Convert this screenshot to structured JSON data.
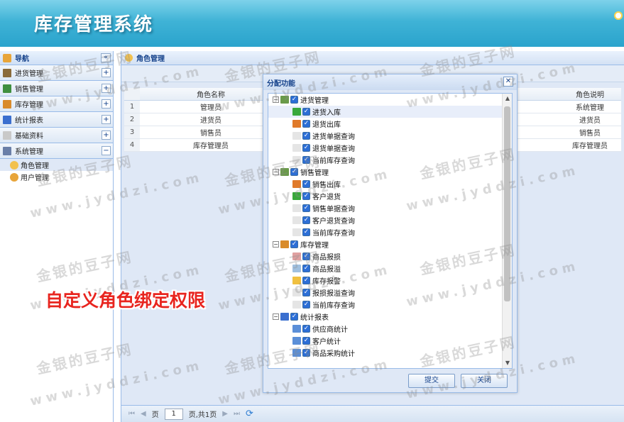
{
  "app": {
    "title": "库存管理系统"
  },
  "nav": {
    "title": "导航",
    "collapse_label": "«",
    "items": [
      {
        "label": "进货管理",
        "toggle": "+",
        "icon_color": "#8a6b3a"
      },
      {
        "label": "销售管理",
        "toggle": "+",
        "icon_color": "#3f8f3f"
      },
      {
        "label": "库存管理",
        "toggle": "+",
        "icon_color": "#d98b2b"
      },
      {
        "label": "统计报表",
        "toggle": "+",
        "icon_color": "#3b6fcf"
      },
      {
        "label": "基础资料",
        "toggle": "+",
        "icon_color": "#c9c9c9"
      },
      {
        "label": "系统管理",
        "toggle": "−",
        "icon_color": "#6a7fa8"
      }
    ],
    "sub_items": [
      {
        "label": "角色管理",
        "selected": true
      },
      {
        "label": "用户管理",
        "selected": false
      }
    ]
  },
  "main": {
    "title": "角色管理",
    "grid": {
      "columns": [
        "角色名称",
        "角色说明"
      ],
      "rows": [
        {
          "num": "1",
          "name": "管理员",
          "desc": "系统管理"
        },
        {
          "num": "2",
          "name": "进货员",
          "desc": "进货员"
        },
        {
          "num": "3",
          "name": "销售员",
          "desc": "销售员"
        },
        {
          "num": "4",
          "name": "库存管理员",
          "desc": "库存管理员"
        }
      ]
    },
    "pager": {
      "first": "⏮",
      "prev": "◀",
      "page_label": "页",
      "page_value": "1",
      "total_label": "页,共1页",
      "next": "▶",
      "last": "⏭",
      "refresh": "⟳"
    }
  },
  "dialog": {
    "title": "分配功能",
    "close_label": "✕",
    "tree": [
      {
        "type": "parent",
        "label": "进货管理",
        "exp": "−",
        "icon_color": "#6a9a4a"
      },
      {
        "type": "child",
        "label": "进货入库",
        "icon_color": "#39a83b",
        "hl": true
      },
      {
        "type": "child",
        "label": "退货出库",
        "icon_color": "#e07a2a"
      },
      {
        "type": "child",
        "label": "进货单据查询",
        "icon_color": "#e5e5e5"
      },
      {
        "type": "child",
        "label": "退货单据查询",
        "icon_color": "#e5e5e5"
      },
      {
        "type": "child",
        "label": "当前库存查询",
        "icon_color": "#e5e5e5"
      },
      {
        "type": "parent",
        "label": "销售管理",
        "exp": "−",
        "icon_color": "#6a9a4a"
      },
      {
        "type": "child",
        "label": "销售出库",
        "icon_color": "#e07a2a"
      },
      {
        "type": "child",
        "label": "客户退货",
        "icon_color": "#39a83b"
      },
      {
        "type": "child",
        "label": "销售单据查询",
        "icon_color": "#e5e5e5"
      },
      {
        "type": "child",
        "label": "客户退货查询",
        "icon_color": "#e5e5e5"
      },
      {
        "type": "child",
        "label": "当前库存查询",
        "icon_color": "#e5e5e5"
      },
      {
        "type": "parent",
        "label": "库存管理",
        "exp": "−",
        "icon_color": "#d98b2b"
      },
      {
        "type": "child",
        "label": "商品报损",
        "icon_color": "#e0a0a0"
      },
      {
        "type": "child",
        "label": "商品报溢",
        "icon_color": "#a0c0e0"
      },
      {
        "type": "child",
        "label": "库存报警",
        "icon_color": "#f0c040"
      },
      {
        "type": "child",
        "label": "报损报溢查询",
        "icon_color": "#e5e5e5"
      },
      {
        "type": "child",
        "label": "当前库存查询",
        "icon_color": "#e5e5e5"
      },
      {
        "type": "parent",
        "label": "统计报表",
        "exp": "−",
        "icon_color": "#3b6fcf"
      },
      {
        "type": "child",
        "label": "供应商统计",
        "icon_color": "#5b8fd8"
      },
      {
        "type": "child",
        "label": "客户统计",
        "icon_color": "#5b8fd8"
      },
      {
        "type": "child",
        "label": "商品采购统计",
        "icon_color": "#5b8fd8"
      }
    ],
    "submit_label": "提交",
    "close_button_label": "关闭"
  },
  "overlay": {
    "caption": "自定义角色绑定权限"
  },
  "watermark": {
    "cn": "金银的豆子网",
    "en": "www.jyddzi.com"
  }
}
